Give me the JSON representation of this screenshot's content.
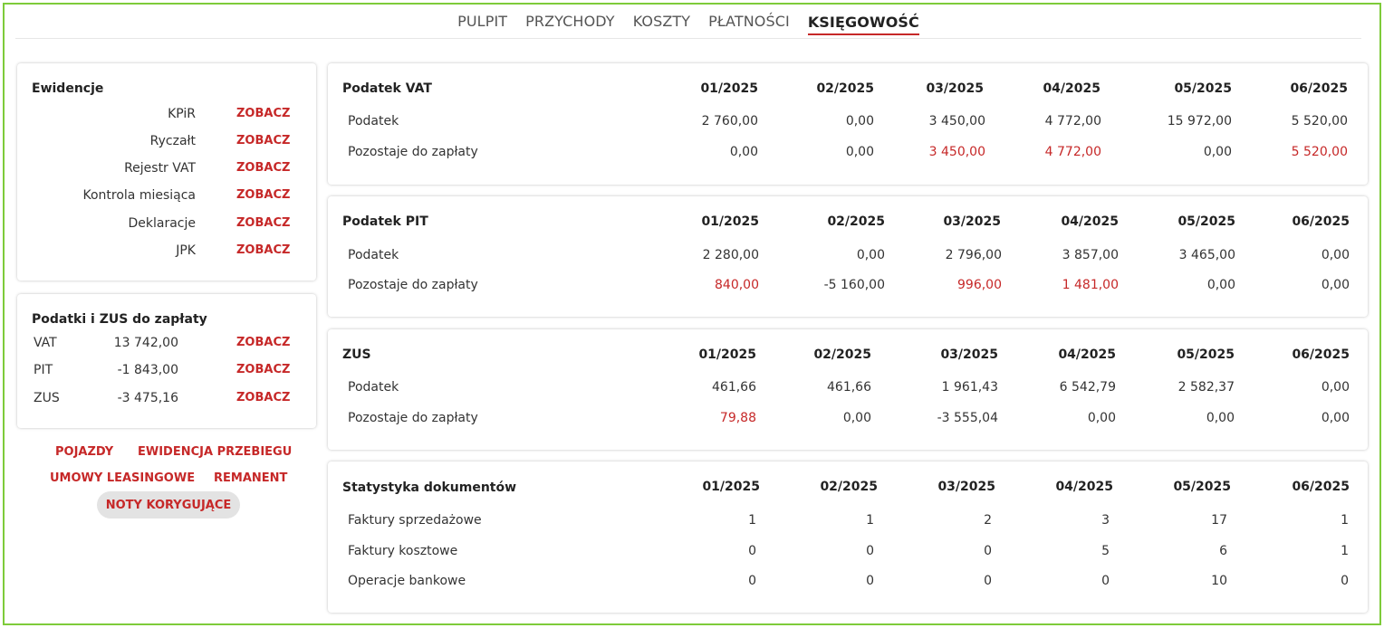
{
  "nav": {
    "tabs": [
      {
        "label": "PULPIT"
      },
      {
        "label": "PRZYCHODY"
      },
      {
        "label": "KOSZTY"
      },
      {
        "label": "PŁATNOŚCI"
      },
      {
        "label": "KSIĘGOWOŚĆ"
      }
    ]
  },
  "ewidencje": {
    "title": "Ewidencje",
    "items": [
      {
        "label": "KPiR",
        "link": "ZOBACZ"
      },
      {
        "label": "Ryczałt",
        "link": "ZOBACZ"
      },
      {
        "label": "Rejestr VAT",
        "link": "ZOBACZ"
      },
      {
        "label": "Kontrola miesiąca",
        "link": "ZOBACZ"
      },
      {
        "label": "Deklaracje",
        "link": "ZOBACZ"
      },
      {
        "label": "JPK",
        "link": "ZOBACZ"
      }
    ]
  },
  "podatki": {
    "title": "Podatki i ZUS do zapłaty",
    "items": [
      {
        "name": "VAT",
        "value": "13 742,00",
        "link": "ZOBACZ"
      },
      {
        "name": "PIT",
        "value": "-1 843,00",
        "link": "ZOBACZ"
      },
      {
        "name": "ZUS",
        "value": "-3 475,16",
        "link": "ZOBACZ"
      }
    ]
  },
  "extra_links": {
    "pojazdy": "POJAZDY",
    "ewidencja_przebiegu": "EWIDENCJA PRZEBIEGU",
    "umowy_leasingowe": "UMOWY LEASINGOWE",
    "remanent": "REMANENT",
    "noty_korygujace": "NOTY KORYGUJĄCE"
  },
  "tables": [
    {
      "title": "Podatek VAT",
      "months": [
        "01/2025",
        "02/2025",
        "03/2025",
        "04/2025",
        "05/2025",
        "06/2025"
      ],
      "rows": [
        {
          "label": "Podatek",
          "values": [
            "2 760,00",
            "0,00",
            "3 450,00",
            "4 772,00",
            "15 972,00",
            "5 520,00"
          ],
          "red": [
            false,
            false,
            false,
            false,
            false,
            false
          ]
        },
        {
          "label": "Pozostaje do zapłaty",
          "values": [
            "0,00",
            "0,00",
            "3 450,00",
            "4 772,00",
            "0,00",
            "5 520,00"
          ],
          "red": [
            false,
            false,
            true,
            true,
            false,
            true
          ]
        }
      ]
    },
    {
      "title": "Podatek PIT",
      "months": [
        "01/2025",
        "02/2025",
        "03/2025",
        "04/2025",
        "05/2025",
        "06/2025"
      ],
      "rows": [
        {
          "label": "Podatek",
          "values": [
            "2 280,00",
            "0,00",
            "2 796,00",
            "3 857,00",
            "3 465,00",
            "0,00"
          ],
          "red": [
            false,
            false,
            false,
            false,
            false,
            false
          ]
        },
        {
          "label": "Pozostaje do zapłaty",
          "values": [
            "840,00",
            "-5 160,00",
            "996,00",
            "1 481,00",
            "0,00",
            "0,00"
          ],
          "red": [
            true,
            false,
            true,
            true,
            false,
            false
          ]
        }
      ]
    },
    {
      "title": "ZUS",
      "months": [
        "01/2025",
        "02/2025",
        "03/2025",
        "04/2025",
        "05/2025",
        "06/2025"
      ],
      "rows": [
        {
          "label": "Podatek",
          "values": [
            "461,66",
            "461,66",
            "1 961,43",
            "6 542,79",
            "2 582,37",
            "0,00"
          ],
          "red": [
            false,
            false,
            false,
            false,
            false,
            false
          ]
        },
        {
          "label": "Pozostaje do zapłaty",
          "values": [
            "79,88",
            "0,00",
            "-3 555,04",
            "0,00",
            "0,00",
            "0,00"
          ],
          "red": [
            true,
            false,
            false,
            false,
            false,
            false
          ]
        }
      ]
    },
    {
      "title": "Statystyka dokumentów",
      "months": [
        "01/2025",
        "02/2025",
        "03/2025",
        "04/2025",
        "05/2025",
        "06/2025"
      ],
      "rows": [
        {
          "label": "Faktury sprzedażowe",
          "values": [
            "1",
            "1",
            "2",
            "3",
            "17",
            "1"
          ],
          "red": [
            false,
            false,
            false,
            false,
            false,
            false
          ]
        },
        {
          "label": "Faktury kosztowe",
          "values": [
            "0",
            "0",
            "0",
            "5",
            "6",
            "1"
          ],
          "red": [
            false,
            false,
            false,
            false,
            false,
            false
          ]
        },
        {
          "label": "Operacje bankowe",
          "values": [
            "0",
            "0",
            "0",
            "0",
            "10",
            "0"
          ],
          "red": [
            false,
            false,
            false,
            false,
            false,
            false
          ]
        }
      ]
    }
  ],
  "colors": {
    "accent": "#c62828",
    "frame": "#7ecb3a",
    "pill": "#e3e3e3"
  }
}
